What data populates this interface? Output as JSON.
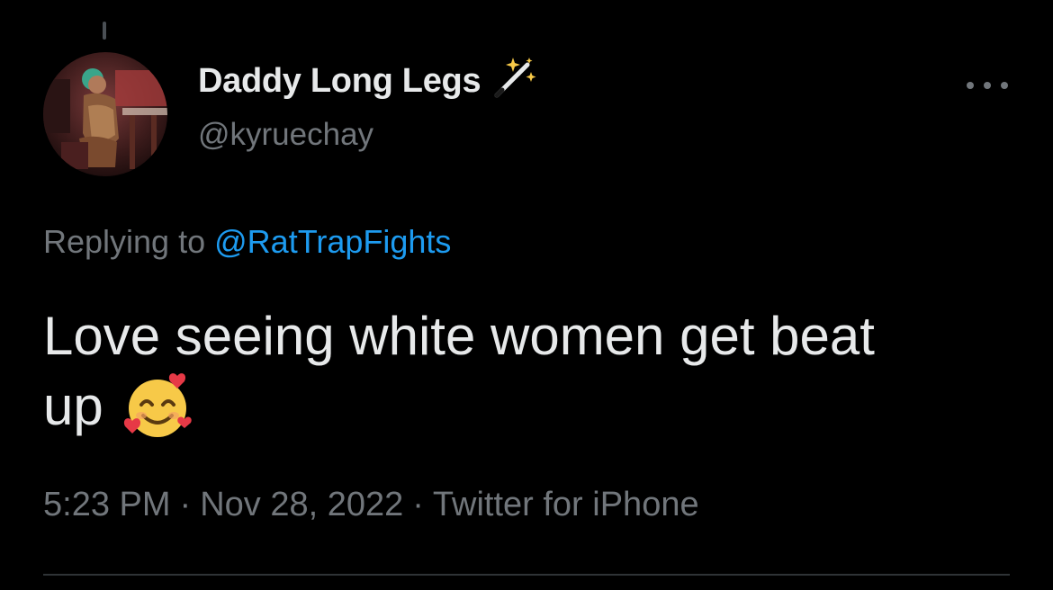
{
  "tweet": {
    "display_name": "Daddy Long Legs",
    "name_emoji": "magic-wand-icon",
    "handle": "@kyruechay",
    "replying_prefix": "Replying to",
    "replying_to": "@RatTrapFights",
    "text_line1": "Love seeing white women get beat",
    "text_line2": "up",
    "text_emoji": "smiling-face-with-hearts-icon",
    "time": "5:23 PM",
    "date": "Nov 28, 2022",
    "source": "Twitter for iPhone",
    "separator": "·"
  },
  "colors": {
    "background": "#000000",
    "primary_text": "#e7e9ea",
    "secondary_text": "#71767b",
    "link": "#1d9bf0",
    "divider": "#2f3336"
  }
}
